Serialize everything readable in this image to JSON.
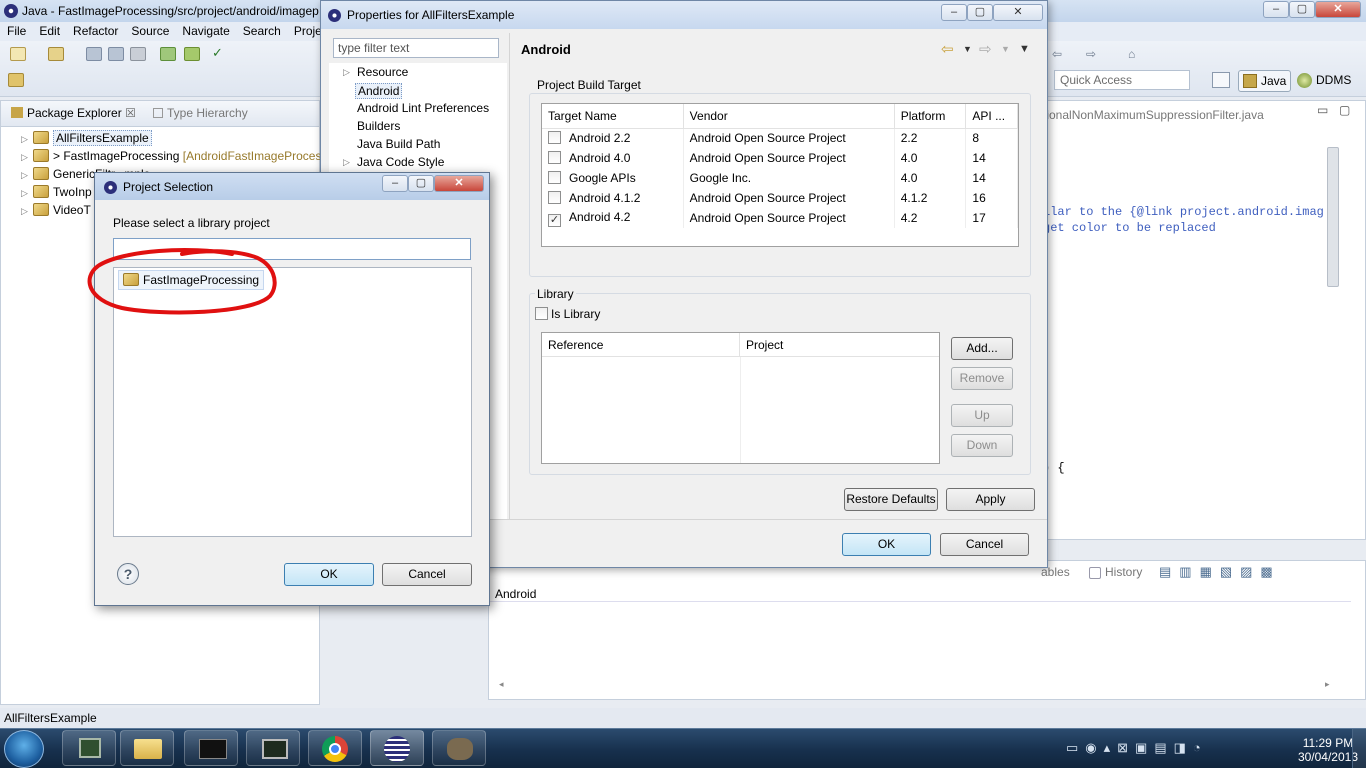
{
  "ide": {
    "title": "Java - FastImageProcessing/src/project/android/imagep",
    "menu": [
      "File",
      "Edit",
      "Refactor",
      "Source",
      "Navigate",
      "Search",
      "Proje"
    ],
    "quick_access": "Quick Access",
    "perspectives": [
      "Java",
      "DDMS"
    ],
    "package_explorer": {
      "tab": "Package Explorer",
      "tab2": "Type Hierarchy",
      "items": [
        {
          "label": "AllFiltersExample",
          "decoration": ""
        },
        {
          "label": "> FastImageProcessing",
          "decoration": "[AndroidFastImageProces"
        },
        {
          "label": "GenericFiltr...mple",
          "decoration": ""
        },
        {
          "label": "TwoInp",
          "decoration": ""
        },
        {
          "label": "VideoT",
          "decoration": ""
        }
      ]
    },
    "editor": {
      "tab": "tionalNonMaximumSuppressionFilter.java",
      "line1": "ilar to the {@link project.android.imag",
      "line2": "get color to be replaced",
      "line3": ") {"
    },
    "bottom_panel": {
      "tab_fragment": "ables",
      "history_tab": "History",
      "content_label": "Android"
    },
    "status": "AllFiltersExample"
  },
  "properties_dialog": {
    "title": "Properties for AllFiltersExample",
    "filter_placeholder": "type filter text",
    "nav": [
      "Resource",
      "Android",
      "Android Lint Preferences",
      "Builders",
      "Java Build Path",
      "Java Code Style"
    ],
    "page_title": "Android",
    "build_target": {
      "label": "Project Build Target",
      "columns": [
        "Target Name",
        "Vendor",
        "Platform",
        "API ..."
      ],
      "rows": [
        {
          "name": "Android 2.2",
          "vendor": "Android Open Source Project",
          "platform": "2.2",
          "api": "8",
          "checked": false
        },
        {
          "name": "Android 4.0",
          "vendor": "Android Open Source Project",
          "platform": "4.0",
          "api": "14",
          "checked": false
        },
        {
          "name": "Google APIs",
          "vendor": "Google Inc.",
          "platform": "4.0",
          "api": "14",
          "checked": false
        },
        {
          "name": "Android 4.1.2",
          "vendor": "Android Open Source Project",
          "platform": "4.1.2",
          "api": "16",
          "checked": false
        },
        {
          "name": "Android 4.2",
          "vendor": "Android Open Source Project",
          "platform": "4.2",
          "api": "17",
          "checked": true
        }
      ]
    },
    "library": {
      "label": "Library",
      "is_library": "Is Library",
      "columns": [
        "Reference",
        "Project"
      ],
      "buttons": {
        "add": "Add...",
        "remove": "Remove",
        "up": "Up",
        "down": "Down"
      }
    },
    "restore_defaults": "Restore Defaults",
    "apply": "Apply",
    "ok": "OK",
    "cancel": "Cancel"
  },
  "project_selection": {
    "title": "Project Selection",
    "prompt": "Please select a library project",
    "search_value": "",
    "items": [
      "FastImageProcessing"
    ],
    "ok": "OK",
    "cancel": "Cancel"
  },
  "taskbar": {
    "time": "11:29 PM",
    "date": "30/04/2013"
  },
  "colors": {
    "annotation_circle": "#e01010",
    "selection": "#eef4fb"
  }
}
